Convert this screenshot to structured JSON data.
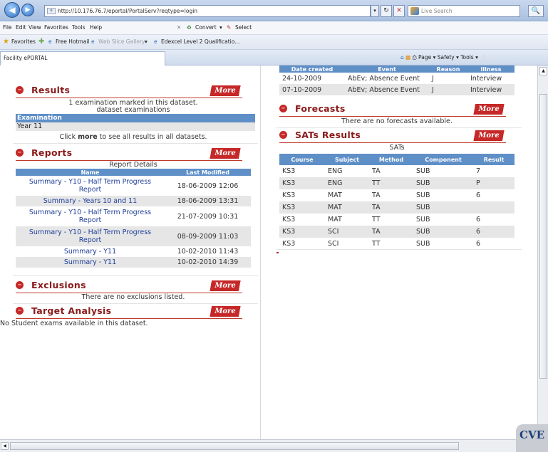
{
  "browser": {
    "url": "http://10.176.76.7/eportal/PortalServ?reqtype=login",
    "search_placeholder": "Live Search",
    "tab_title": "Facility ePORTAL",
    "menu": [
      "File",
      "Edit",
      "View",
      "Favorites",
      "Tools",
      "Help"
    ],
    "convert_label": "Convert",
    "select_label": "Select",
    "favorites_label": "Favorites",
    "favorites_links": [
      "Free Hotmail",
      "Web Slice Gallery",
      "Edexcel Level 2 Qualificatio..."
    ],
    "command_bar": "Page ▾  Safety ▾  Tools ▾",
    "corner_logo": "CVE"
  },
  "results": {
    "title": "Results",
    "more_label": "More",
    "summary_line1": "1 examination marked in this dataset.",
    "summary_line2": "dataset examinations",
    "table_header": "Examination",
    "rows": [
      "Year 11"
    ],
    "footer_prefix": "Click ",
    "footer_more": "more",
    "footer_suffix": " to see all results in all datasets."
  },
  "reports": {
    "title": "Reports",
    "more_label": "More",
    "subtitle": "Report Details",
    "col_name": "Name",
    "col_modified": "Last Modified",
    "rows": [
      {
        "name": "Summary - Y10 - Half Term Progress Report",
        "date": "18-06-2009 12:06"
      },
      {
        "name": "Summary - Years 10 and 11",
        "date": "18-06-2009 13:31"
      },
      {
        "name": "Summary - Y10 - Half Term Progress Report",
        "date": "21-07-2009 10:31"
      },
      {
        "name": "Summary - Y10 - Half Term Progress Report",
        "date": "08-09-2009 11:03"
      },
      {
        "name": "Summary - Y11",
        "date": "10-02-2010 11:43"
      },
      {
        "name": "Summary - Y11",
        "date": "10-02-2010 14:39"
      }
    ]
  },
  "exclusions": {
    "title": "Exclusions",
    "more_label": "More",
    "empty_text": "There are no exclusions listed."
  },
  "target_analysis": {
    "title": "Target Analysis",
    "more_label": "More",
    "empty_text": "No Student exams available in this dataset."
  },
  "absences": {
    "columns": [
      "Date created",
      "Event",
      "Reason",
      "Illness"
    ],
    "rows": [
      {
        "date": "24-10-2009",
        "event": "AbEv; Absence Event",
        "reason": "J",
        "illness": "Interview"
      },
      {
        "date": "07-10-2009",
        "event": "AbEv; Absence Event",
        "reason": "J",
        "illness": "Interview"
      }
    ]
  },
  "forecasts": {
    "title": "Forecasts",
    "more_label": "More",
    "empty_text": "There are no forecasts available."
  },
  "sats": {
    "title": "SATs Results",
    "more_label": "More",
    "subtitle": "SATs",
    "columns": [
      "Course",
      "Subject",
      "Method",
      "Component",
      "Result"
    ],
    "rows": [
      {
        "course": "KS3",
        "subject": "ENG",
        "method": "TA",
        "component": "SUB",
        "result": "7"
      },
      {
        "course": "KS3",
        "subject": "ENG",
        "method": "TT",
        "component": "SUB",
        "result": "P"
      },
      {
        "course": "KS3",
        "subject": "MAT",
        "method": "TA",
        "component": "SUB",
        "result": "6"
      },
      {
        "course": "KS3",
        "subject": "MAT",
        "method": "TA",
        "component": "SUB",
        "result": ""
      },
      {
        "course": "KS3",
        "subject": "MAT",
        "method": "TT",
        "component": "SUB",
        "result": "6"
      },
      {
        "course": "KS3",
        "subject": "SCI",
        "method": "TA",
        "component": "SUB",
        "result": "6"
      },
      {
        "course": "KS3",
        "subject": "SCI",
        "method": "TT",
        "component": "SUB",
        "result": "6"
      }
    ]
  }
}
